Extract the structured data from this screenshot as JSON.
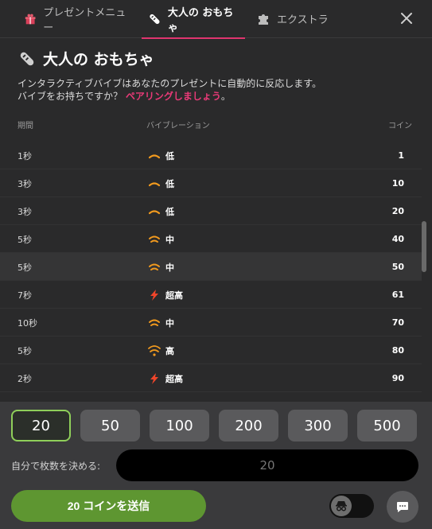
{
  "tabs": [
    {
      "label": "プレゼントメニュー",
      "icon": "gift-box-icon"
    },
    {
      "label": "大人の おもちゃ",
      "icon": "vibrator-icon"
    },
    {
      "label": "エクストラ",
      "icon": "puzzle-piece-icon"
    }
  ],
  "active_tab": 1,
  "header": {
    "title": "大人の おもちゃ",
    "desc_line1": "インタラクティブバイブはあなたのプレゼントに自動的に反応します。",
    "desc_line2_prefix": "バイブをお持ちですか？ ",
    "pair_link": "ペアリングしましょう",
    "desc_line2_suffix": "。"
  },
  "table": {
    "headers": {
      "duration": "期間",
      "vibration": "バイブレーション",
      "coins": "コイン"
    },
    "rows": [
      {
        "duration": "1秒",
        "level": "低",
        "icon": "low-wave-icon",
        "coins": "1"
      },
      {
        "duration": "3秒",
        "level": "低",
        "icon": "low-wave-icon",
        "coins": "10"
      },
      {
        "duration": "3秒",
        "level": "低",
        "icon": "low-wave-icon",
        "coins": "20"
      },
      {
        "duration": "5秒",
        "level": "中",
        "icon": "medium-wave-icon",
        "coins": "40"
      },
      {
        "duration": "5秒",
        "level": "中",
        "icon": "medium-wave-icon",
        "coins": "50"
      },
      {
        "duration": "7秒",
        "level": "超高",
        "icon": "lightning-icon",
        "coins": "61"
      },
      {
        "duration": "10秒",
        "level": "中",
        "icon": "medium-wave-icon",
        "coins": "70"
      },
      {
        "duration": "5秒",
        "level": "高",
        "icon": "high-wave-icon",
        "coins": "80"
      },
      {
        "duration": "2秒",
        "level": "超高",
        "icon": "lightning-icon",
        "coins": "90"
      }
    ],
    "highlighted_row": 4
  },
  "amounts": [
    "20",
    "50",
    "100",
    "200",
    "300",
    "500"
  ],
  "selected_amount": 0,
  "custom": {
    "label": "自分で枚数を決める:",
    "placeholder": "20"
  },
  "send_button": "20 コインを送信",
  "colors": {
    "accent": "#e0356f",
    "send": "#5e9631",
    "selected_border": "#8fcf5a",
    "wave_orange": "#f29a1e",
    "lightning": "#f0452a"
  }
}
